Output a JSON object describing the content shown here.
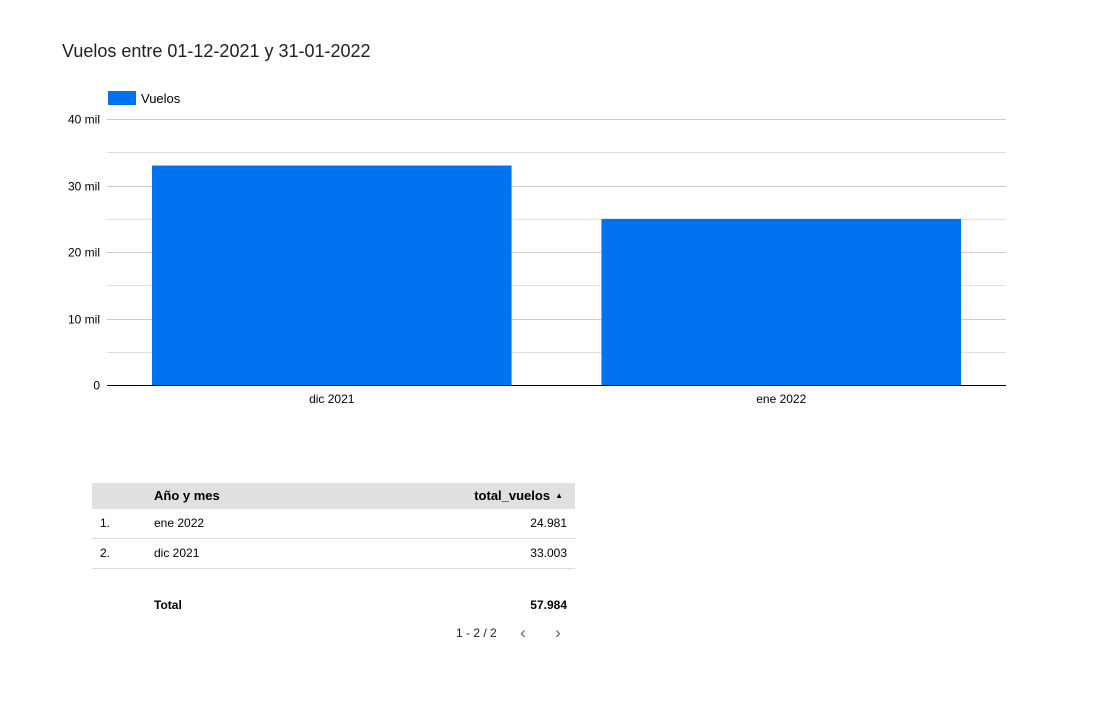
{
  "chart_data": {
    "type": "bar",
    "title": "Vuelos entre 01-12-2021 y 31-01-2022",
    "categories": [
      "dic 2021",
      "ene 2022"
    ],
    "series": [
      {
        "name": "Vuelos",
        "values": [
          33003,
          24981
        ],
        "color": "#0072f0"
      }
    ],
    "ylim": [
      0,
      40000
    ],
    "yticks": [
      0,
      10000,
      20000,
      30000,
      40000
    ],
    "ytick_labels": [
      "0",
      "10 mil",
      "20 mil",
      "30 mil",
      "40 mil"
    ],
    "xlabel": "",
    "ylabel": "",
    "legend": "top-left",
    "grid": true
  },
  "table": {
    "headers": {
      "dimension": "Año y mes",
      "metric": "total_vuelos"
    },
    "sort_icon": "sort-ascending-icon",
    "rows": [
      {
        "index": "1.",
        "dimension": "ene 2022",
        "value": "24.981"
      },
      {
        "index": "2.",
        "dimension": "dic 2021",
        "value": "33.003"
      }
    ],
    "total_label": "Total",
    "total_value": "57.984",
    "pagination": "1 - 2 / 2"
  }
}
